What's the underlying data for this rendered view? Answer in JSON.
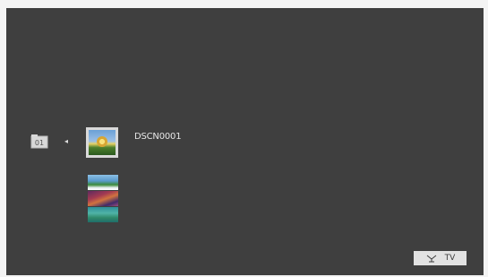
{
  "screen": {
    "folder_icon": "folder-icon",
    "nav_arrow": "◂",
    "selected_file_name": "DSCN0001",
    "thumbnails": [
      {
        "name": "thumbnail-beach"
      },
      {
        "name": "thumbnail-festival"
      },
      {
        "name": "thumbnail-underwater"
      }
    ],
    "tv_button": {
      "icon": "antenna-icon",
      "label": "TV"
    }
  },
  "colors": {
    "screen_bg": "#3f3f3f",
    "border_bg": "#f4f4f4",
    "text": "#e6e6e6"
  }
}
